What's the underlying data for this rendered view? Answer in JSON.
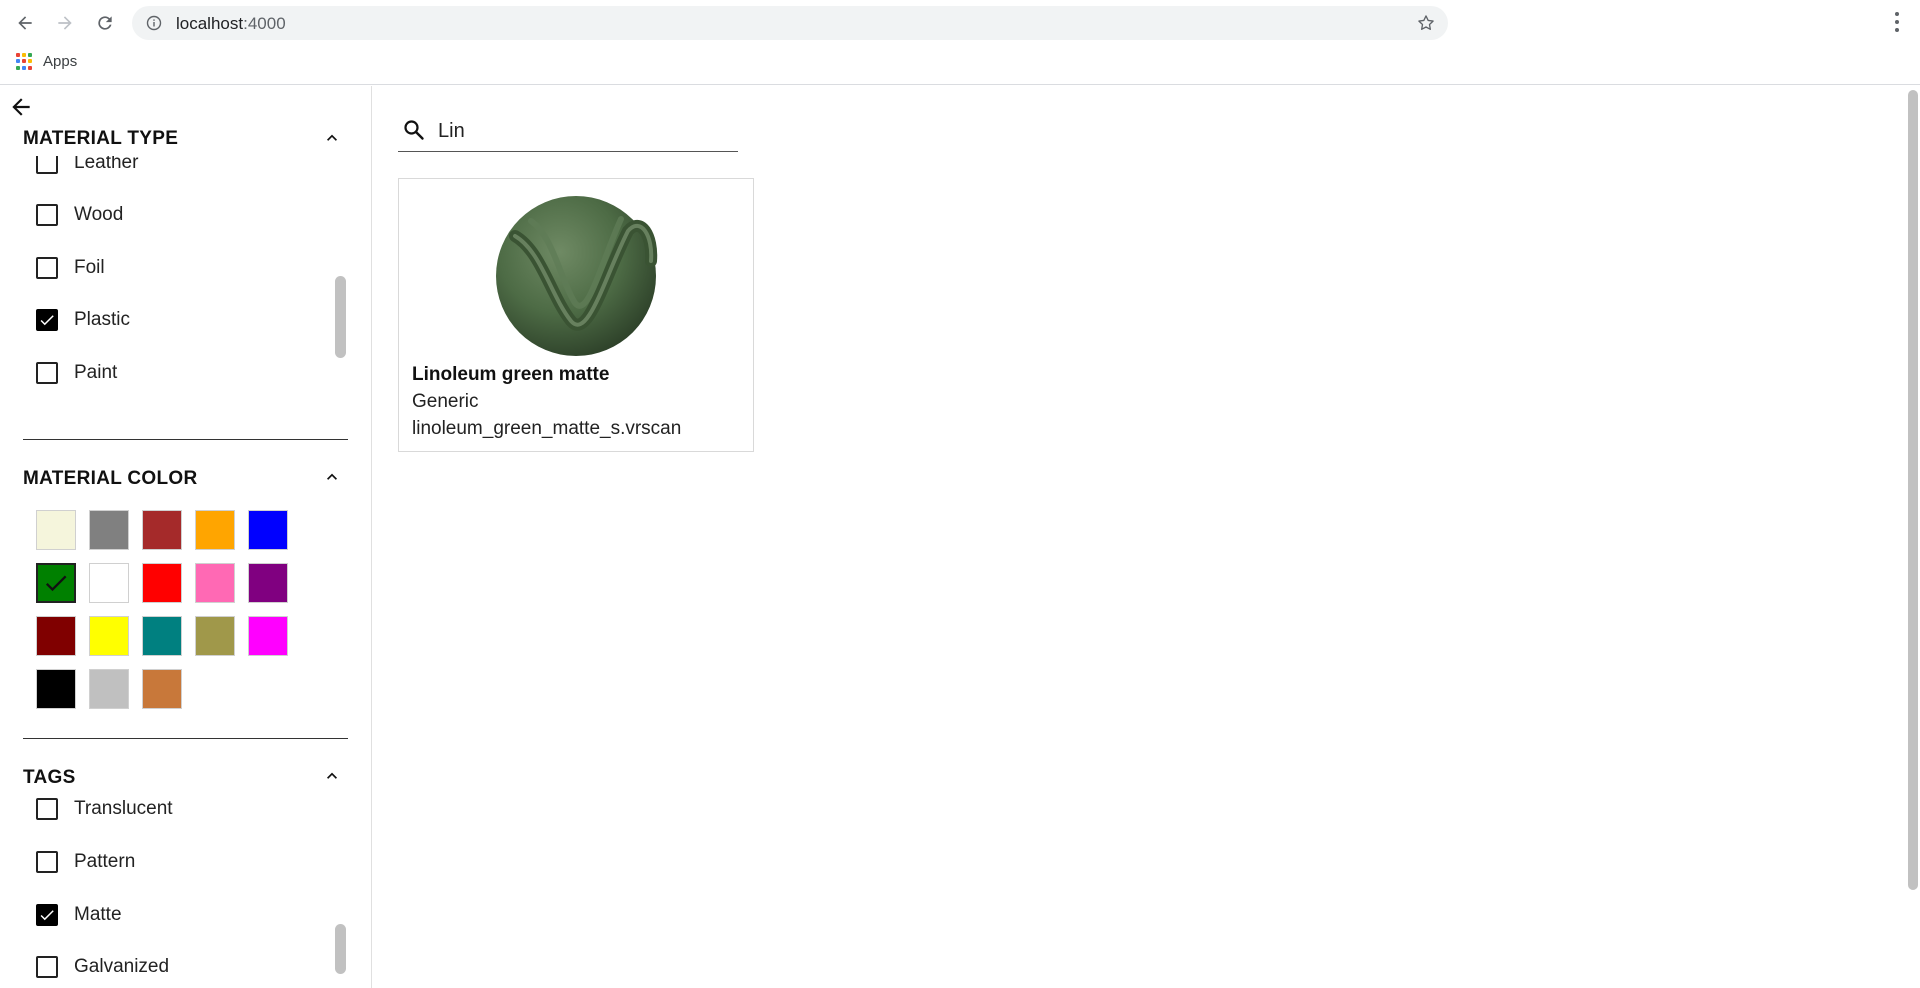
{
  "browser": {
    "url_host": "localhost",
    "url_port": ":4000",
    "bookmarks": [
      {
        "label": "Apps"
      }
    ]
  },
  "sidebar": {
    "material_type": {
      "title": "MATERIAL TYPE",
      "items": [
        {
          "label": "Leather",
          "checked": false
        },
        {
          "label": "Wood",
          "checked": false
        },
        {
          "label": "Foil",
          "checked": false
        },
        {
          "label": "Plastic",
          "checked": true
        },
        {
          "label": "Paint",
          "checked": false
        }
      ]
    },
    "material_color": {
      "title": "MATERIAL COLOR",
      "swatches": [
        {
          "name": "beige",
          "color": "#f5f5dc",
          "selected": false
        },
        {
          "name": "gray",
          "color": "#808080",
          "selected": false
        },
        {
          "name": "brown",
          "color": "#a52a2a",
          "selected": false
        },
        {
          "name": "orange",
          "color": "#ffa500",
          "selected": false
        },
        {
          "name": "blue",
          "color": "#0000ff",
          "selected": false
        },
        {
          "name": "green",
          "color": "#008000",
          "selected": true
        },
        {
          "name": "white",
          "color": "#ffffff",
          "selected": false
        },
        {
          "name": "red",
          "color": "#ff0000",
          "selected": false
        },
        {
          "name": "pink",
          "color": "#ff69b4",
          "selected": false
        },
        {
          "name": "purple",
          "color": "#800080",
          "selected": false
        },
        {
          "name": "maroon",
          "color": "#800000",
          "selected": false
        },
        {
          "name": "yellow",
          "color": "#ffff00",
          "selected": false
        },
        {
          "name": "teal",
          "color": "#008080",
          "selected": false
        },
        {
          "name": "olive",
          "color": "#a0984a",
          "selected": false
        },
        {
          "name": "magenta",
          "color": "#ff00ff",
          "selected": false
        },
        {
          "name": "black",
          "color": "#000000",
          "selected": false
        },
        {
          "name": "silver",
          "color": "#c0c0c0",
          "selected": false
        },
        {
          "name": "copper",
          "color": "#c8783a",
          "selected": false
        }
      ]
    },
    "tags": {
      "title": "TAGS",
      "items": [
        {
          "label": "Translucent",
          "checked": false
        },
        {
          "label": "Pattern",
          "checked": false
        },
        {
          "label": "Matte",
          "checked": true
        },
        {
          "label": "Galvanized",
          "checked": false
        }
      ]
    }
  },
  "main": {
    "search": {
      "value": "Lin"
    },
    "results": [
      {
        "name": "Linoleum green matte",
        "category": "Generic",
        "file": "linoleum_green_matte_s.vrscan",
        "preview_color": "#4d6b45"
      }
    ]
  }
}
